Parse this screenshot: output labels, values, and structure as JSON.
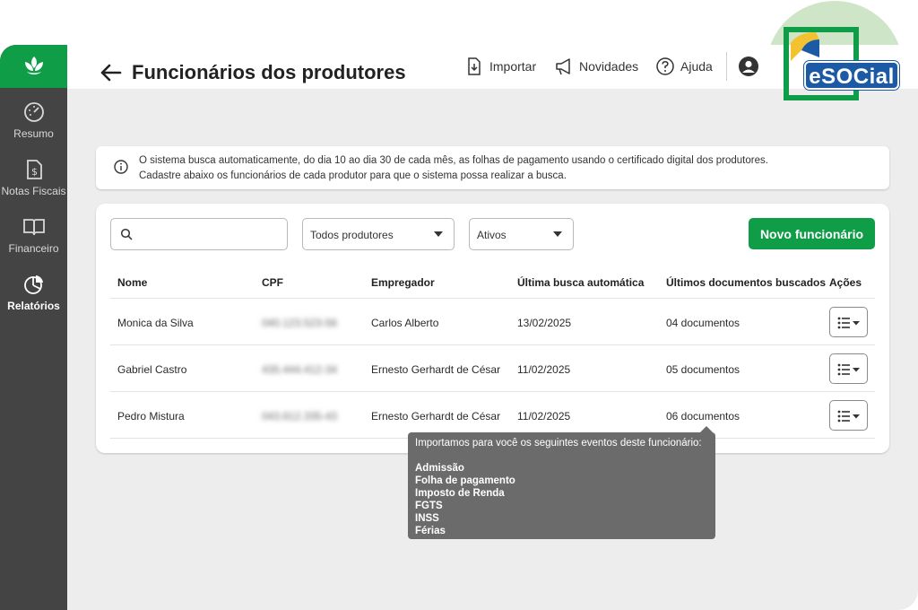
{
  "sidebar": {
    "items": [
      {
        "label": "Resumo",
        "icon": "gauge-icon",
        "active": false
      },
      {
        "label": "Notas Fiscais",
        "icon": "invoice-icon",
        "active": false
      },
      {
        "label": "Financeiro",
        "icon": "book-icon",
        "active": false
      },
      {
        "label": "Relatórios",
        "icon": "pie-chart-icon",
        "active": true
      }
    ]
  },
  "topnav": {
    "import_label": "Importar",
    "news_label": "Novidades",
    "help_label": "Ajuda"
  },
  "header": {
    "title": "Funcionários dos produtores"
  },
  "info": {
    "line1": "O sistema busca automaticamente, do dia 10 ao dia 30 de cada mês, as folhas de pagamento usando o certificado digital dos produtores.",
    "line2": "Cadastre abaixo os funcionários de cada produtor para que o sistema possa realizar a busca."
  },
  "filters": {
    "search_placeholder": "",
    "producer_select": "Todos produtores",
    "status_select": "Ativos",
    "new_button": "Novo funcionário"
  },
  "table": {
    "headers": [
      "Nome",
      "CPF",
      "Empregador",
      "Última busca automática",
      "Últimos documentos buscados",
      "Ações"
    ],
    "rows": [
      {
        "nome": "Monica da Silva",
        "cpf": "040.123.523-56",
        "empregador": "Carlos Alberto",
        "ultima": "13/02/2025",
        "docs": "04 documentos"
      },
      {
        "nome": "Gabriel Castro",
        "cpf": "435.444.412-34",
        "empregador": "Ernesto Gerhardt de César",
        "ultima": "11/02/2025",
        "docs": "05 documentos"
      },
      {
        "nome": "Pedro Mistura",
        "cpf": "043.612.335-43",
        "empregador": "Ernesto Gerhardt de César",
        "ultima": "11/02/2025",
        "docs": "06 documentos"
      }
    ]
  },
  "tooltip": {
    "intro": "Importamos para você os seguintes eventos deste funcionário:",
    "events": [
      "Admissão",
      "Folha de pagamento",
      "Imposto de Renda",
      "FGTS",
      "INSS",
      "Férias"
    ]
  },
  "badge": {
    "label": "eSOCial"
  },
  "colors": {
    "brand_green": "#0f9d48",
    "sidebar": "#444444",
    "badge_blue": "#1d5aa6"
  }
}
